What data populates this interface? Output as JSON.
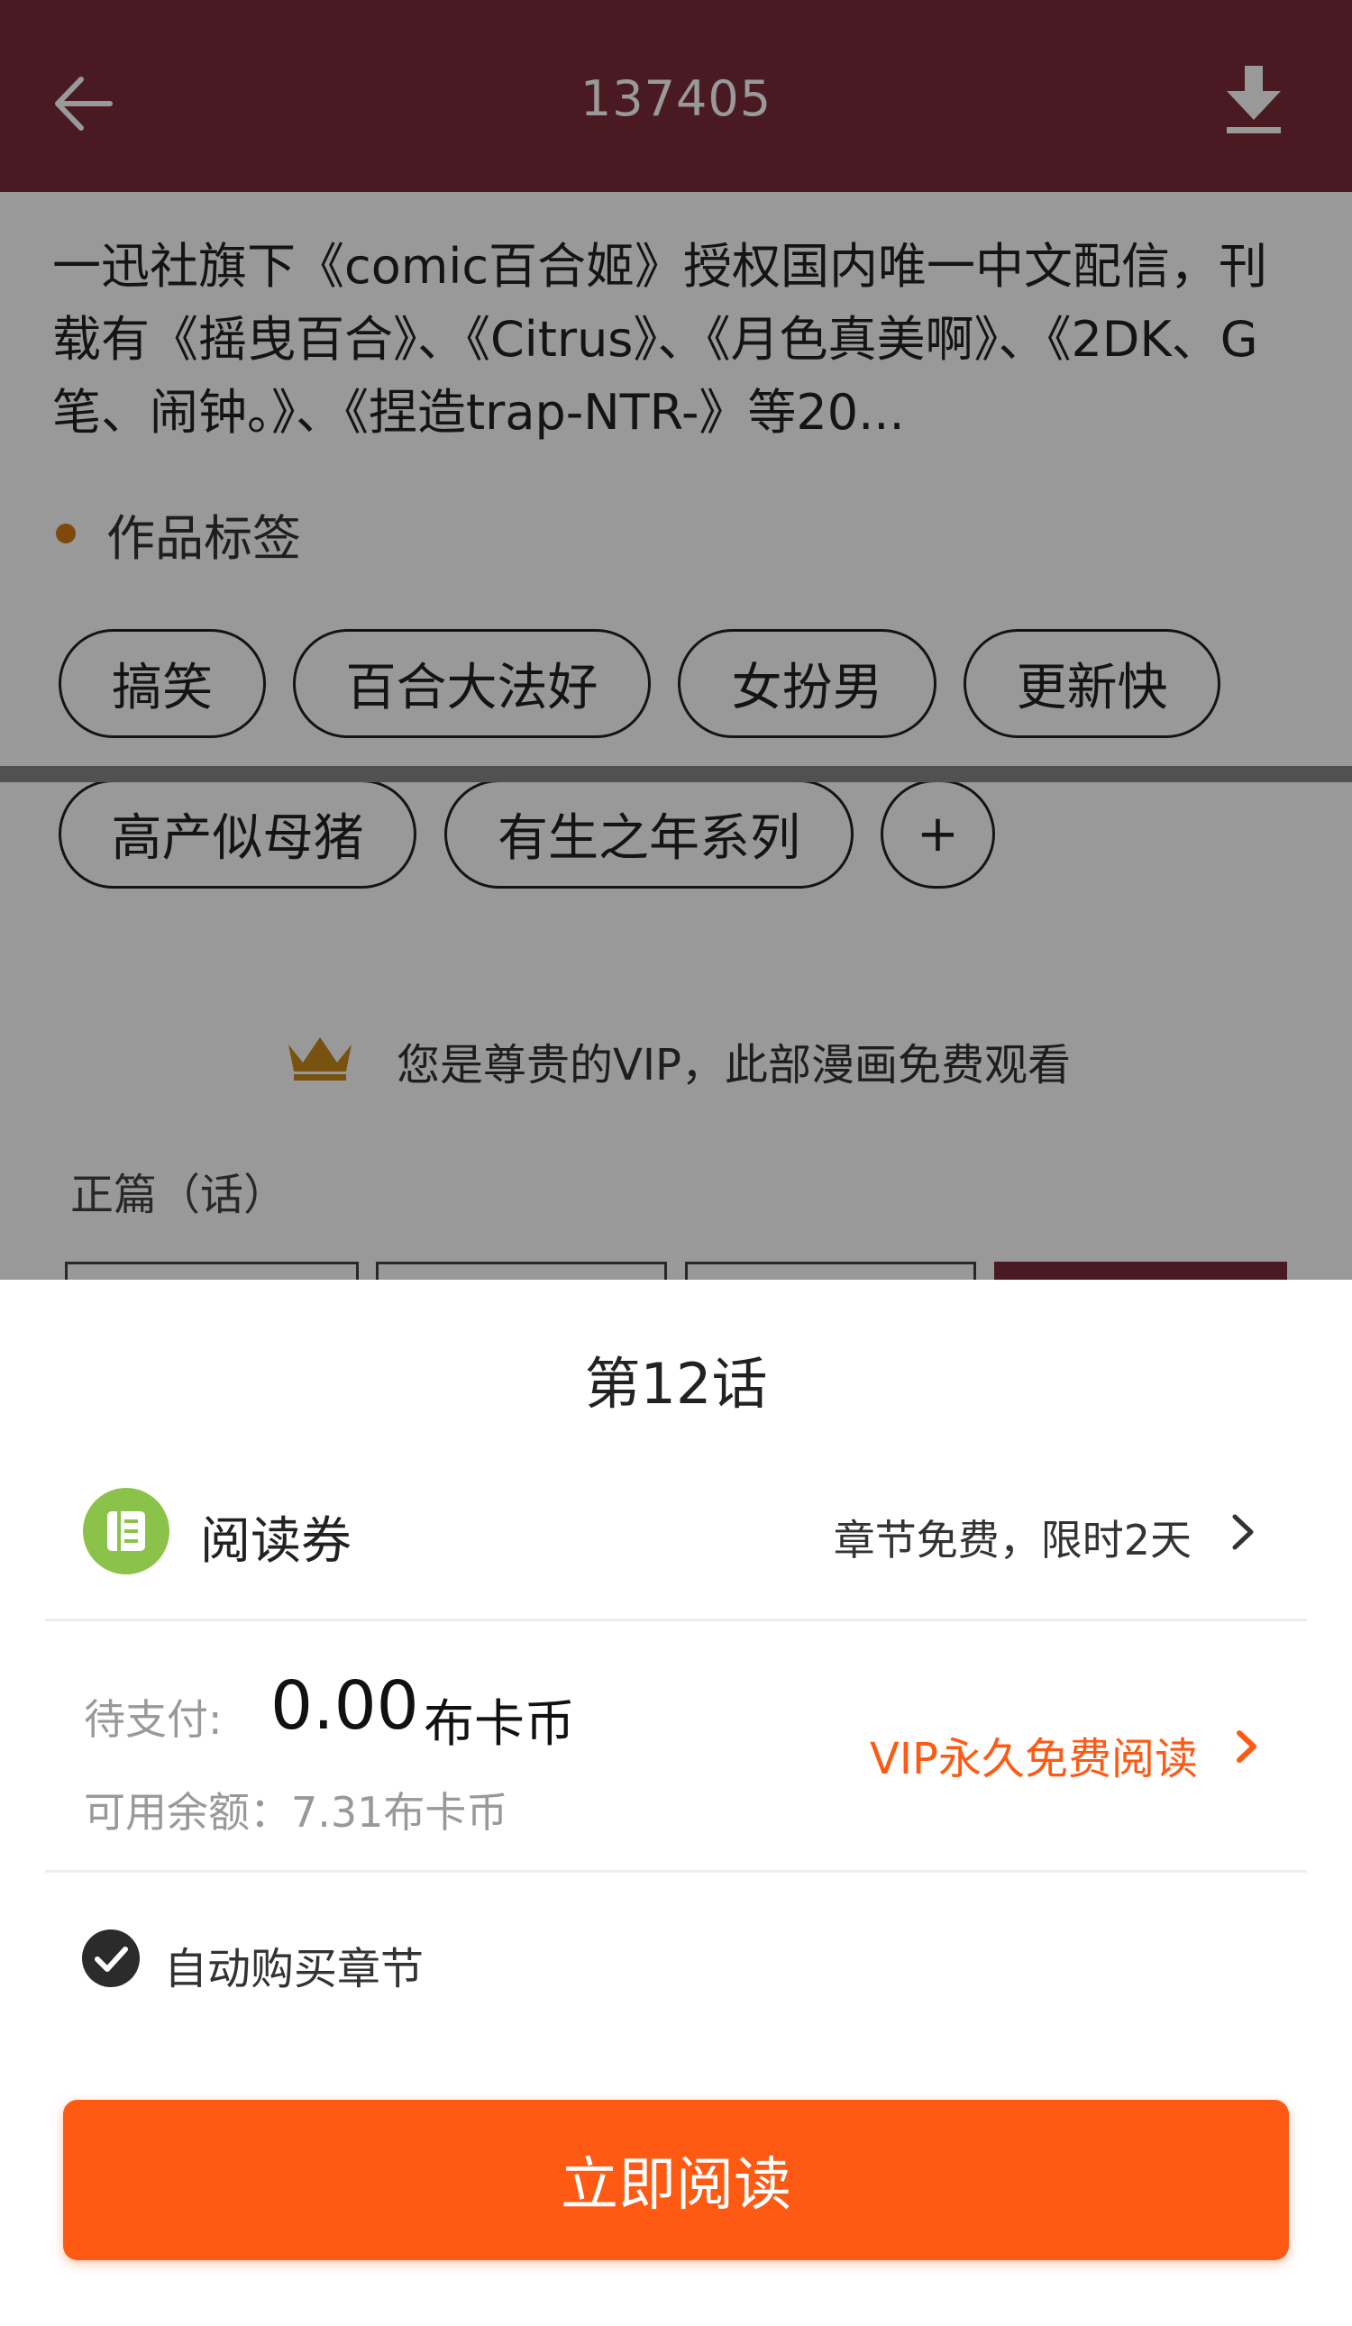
{
  "header": {
    "title": "137405"
  },
  "description": "一迅社旗下《comic百合姬》授权国内唯一中文配信，刊载有《摇曳百合》、《Citrus》、《月色真美啊》、《2DK、G笔、闹钟。》、《捏造trap-NTR-》等20...",
  "tags_section": {
    "heading": "作品标签",
    "tags": [
      "搞笑",
      "百合大法好",
      "女扮男",
      "更新快",
      "高产似母猪",
      "有生之年系列"
    ],
    "add_symbol": "+"
  },
  "vip_banner": {
    "text": "您是尊贵的VIP，此部漫画免费观看"
  },
  "chapters": {
    "section_title": "正篇（话）"
  },
  "sheet": {
    "title": "第12话",
    "coupon": {
      "label": "阅读券",
      "info": "章节免费，限时2天"
    },
    "payment": {
      "pay_label": "待支付:",
      "amount": "0.00",
      "unit": "布卡币",
      "balance": "可用余额：7.31布卡币",
      "vip_link": "VIP永久免费阅读"
    },
    "auto_buy": {
      "label": "自动购买章节",
      "checked": true
    },
    "read_button": "立即阅读"
  },
  "colors": {
    "header": "#7c2c3a",
    "accent": "#ff5a14",
    "coupon_green": "#8bc34a"
  }
}
